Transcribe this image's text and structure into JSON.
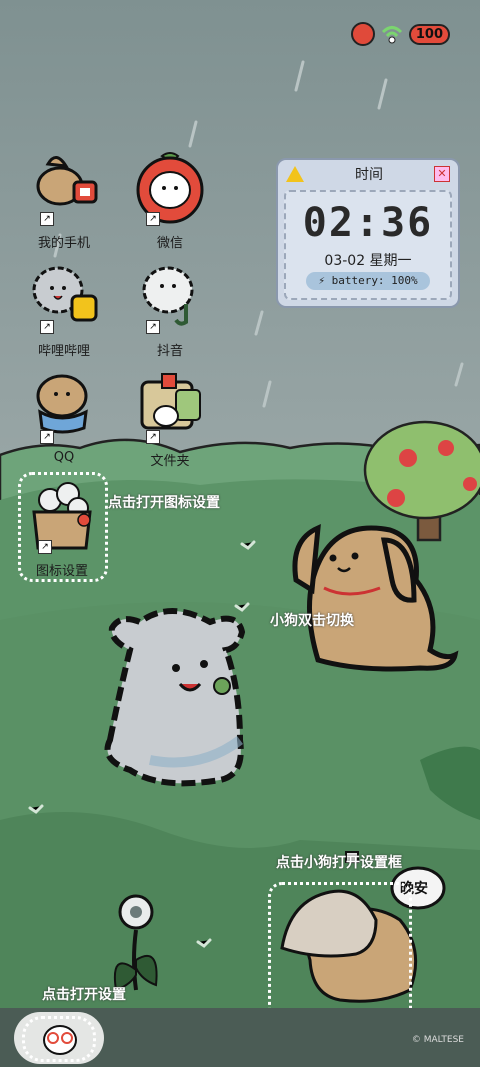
{
  "status": {
    "battery": "100"
  },
  "apps": [
    {
      "label": "我的手机"
    },
    {
      "label": "微信"
    },
    {
      "label": "哔哩哔哩"
    },
    {
      "label": "抖音"
    },
    {
      "label": "QQ"
    },
    {
      "label": "文件夹"
    },
    {
      "label": "图标设置"
    }
  ],
  "widget": {
    "title": "时间",
    "time": "02:36",
    "date": "03-02  星期一",
    "battery": "battery:  100%"
  },
  "hints": {
    "icon_settings": "点击打开图标设置",
    "dog_switch": "小狗双击切换",
    "dog_settings": "点击小狗打开设置框",
    "open_settings": "点击打开设置",
    "speech": "晚安"
  },
  "copyright": "© MALTESE",
  "colors": {
    "sky": "#8b9aa0",
    "grass": "#4f8a5c",
    "dog_tan": "#c9a577",
    "tomato": "#e24b3b"
  }
}
